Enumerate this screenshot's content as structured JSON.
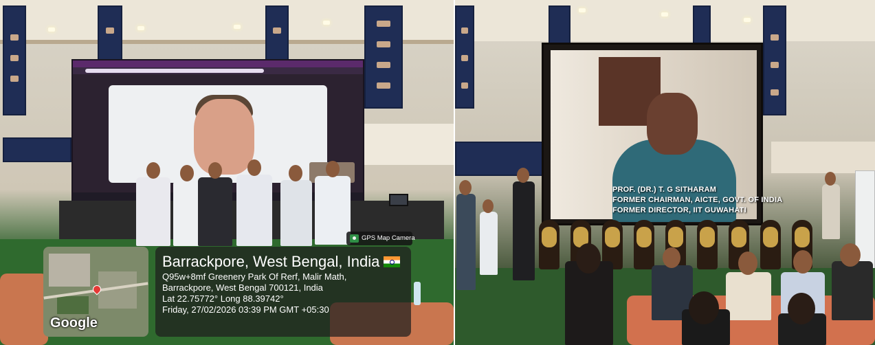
{
  "left_photo": {
    "gps_overlay": {
      "badge_label": "GPS Map Camera",
      "map_brand": "Google",
      "location_title": "Barrackpore, West Bengal, India",
      "address_line_1": "Q95w+8mf Greenery Park Of Rerf, Malir Math,",
      "address_line_2": "Barrackpore, West Bengal 700121, India",
      "coordinates": "Lat 22.75772° Long 88.39742°",
      "timestamp": "Friday, 27/02/2026 03:39 PM GMT +05:30",
      "icons": [
        "gps-camera-icon",
        "map-pin-icon",
        "india-flag-icon"
      ]
    }
  },
  "right_photo": {
    "screen_caption": {
      "line_1": "PROF. (DR.) T. G SITHARAM",
      "line_2": "FORMER CHAIRMAN, AICTE, GOVT. OF INDIA",
      "line_3": "FORMER DIRECTOR, IIT GUWAHATI"
    }
  },
  "colors": {
    "banner_navy": "#1f2d55",
    "stage_grass": "#2f6a2e",
    "sofa_orange": "#c9764f",
    "overlay_dark": "#1e1e1e"
  }
}
